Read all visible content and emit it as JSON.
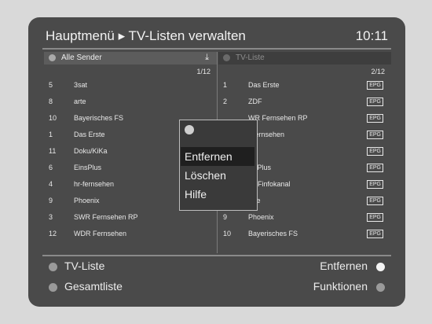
{
  "header": {
    "title": "Hauptmenü ▸ TV-Listen verwalten",
    "time": "10:11"
  },
  "left_panel": {
    "header": "Alle Sender",
    "download_icon": "download-icon",
    "pager": "1/12",
    "rows": [
      {
        "num": "5",
        "name": "3sat"
      },
      {
        "num": "8",
        "name": "arte"
      },
      {
        "num": "10",
        "name": "Bayerisches FS"
      },
      {
        "num": "1",
        "name": "Das Erste"
      },
      {
        "num": "11",
        "name": "Doku/KiKa"
      },
      {
        "num": "6",
        "name": "EinsPlus"
      },
      {
        "num": "4",
        "name": "hr-fernsehen"
      },
      {
        "num": "9",
        "name": "Phoenix"
      },
      {
        "num": "3",
        "name": "SWR Fernsehen RP"
      },
      {
        "num": "12",
        "name": "WDR Fernsehen"
      }
    ]
  },
  "right_panel": {
    "header": "TV-Liste",
    "pager": "2/12",
    "badge": "EPG",
    "rows": [
      {
        "num": "1",
        "name": "Das Erste"
      },
      {
        "num": "2",
        "name": "ZDF"
      },
      {
        "num": "",
        "name": "WR Fernsehen RP"
      },
      {
        "num": "",
        "name": "r-fernsehen"
      },
      {
        "num": "",
        "name": "sat"
      },
      {
        "num": "",
        "name": "insPlus"
      },
      {
        "num": "",
        "name": "ZDFinfokanal"
      },
      {
        "num": "",
        "name": "arte"
      },
      {
        "num": "9",
        "name": "Phoenix"
      },
      {
        "num": "10",
        "name": "Bayerisches FS"
      }
    ]
  },
  "popup": {
    "items": [
      "Entfernen",
      "Löschen",
      "Hilfe"
    ],
    "selected_index": 0
  },
  "footer": {
    "left": [
      "TV-Liste",
      "Gesamtliste"
    ],
    "right": [
      "Entfernen",
      "Funktionen"
    ]
  },
  "colors": {
    "background": "#4a4a4a",
    "white_button": "#f4f4f4",
    "grey_button": "#9a9a9a"
  }
}
